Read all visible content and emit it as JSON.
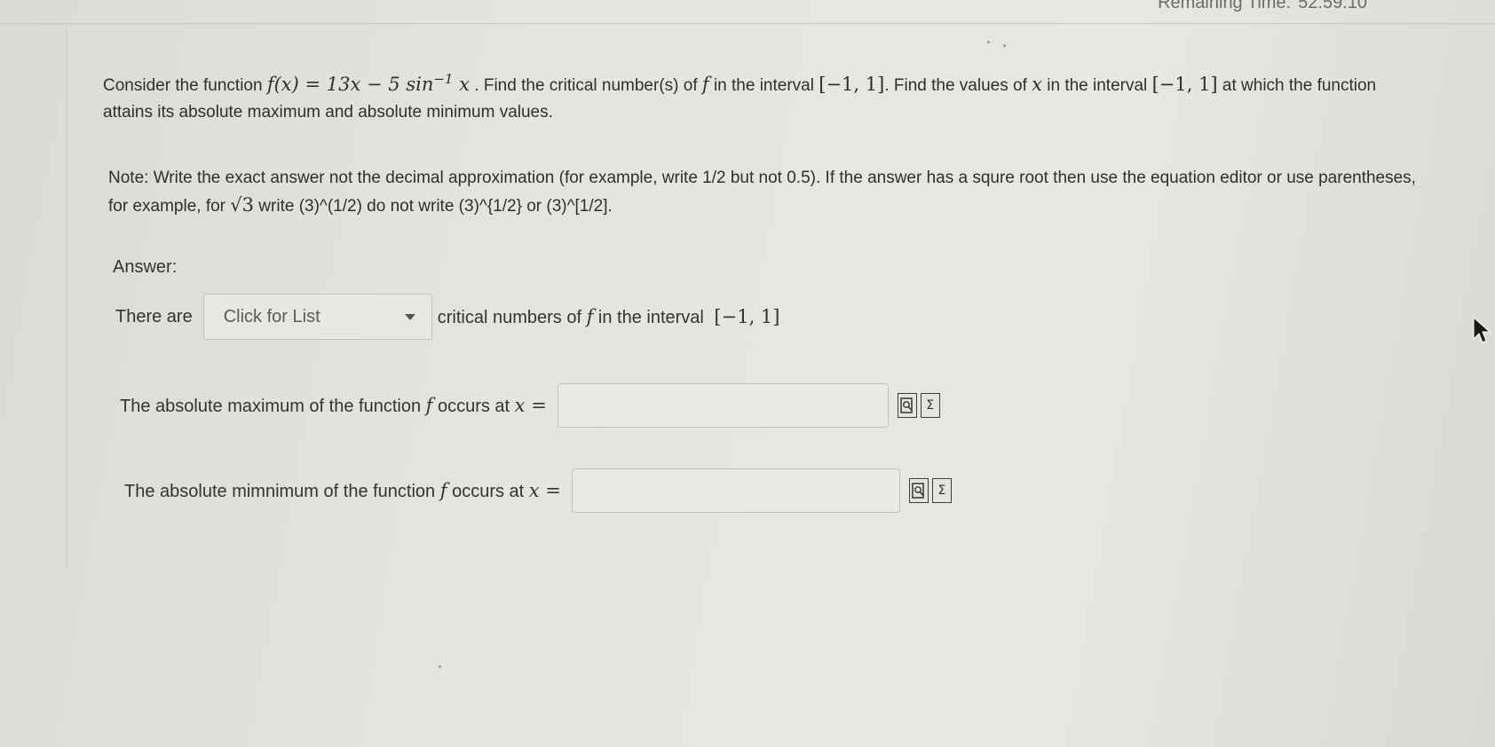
{
  "header": {
    "timer_label": "Remaining Time:",
    "timer_value": "52:59:10"
  },
  "question": {
    "p1_a": "Consider the function ",
    "p1_math_fx": "f(x) = 13x − 5 sin",
    "p1_math_sup": "−1",
    "p1_math_x": " x",
    "p1_b": " . Find the critical number(s) of ",
    "p1_f": "f",
    "p1_c": " in the interval ",
    "p1_interval1": "[−1, 1]",
    "p1_d": ". Find the values of ",
    "p1_x": "x",
    "p1_e": " in the interval ",
    "p1_interval2": "[−1, 1]",
    "p1_f_text": " at which the function attains its absolute maximum and absolute minimum values.",
    "p2_a": "Note: Write the exact answer not the decimal approximation (for example, write 1/2 but not 0.5). If the answer has a squre root then use the equation editor or use parentheses, for example, for ",
    "p2_sqrt": "√3",
    "p2_b": " write (3)^(1/2) do not write (3)^{1/2} or (3)^[1/2]."
  },
  "answer": {
    "label": "Answer:",
    "row1_prefix": "There are",
    "dropdown_value": "Click for List",
    "row1_suffix_a": "critical numbers of ",
    "row1_f": "f",
    "row1_suffix_b": " in the interval ",
    "row1_interval": "[−1, 1]",
    "row2_label_a": "The absolute maximum of the function ",
    "row2_f": "f",
    "row2_label_b": " occurs at ",
    "row2_eq": "x =",
    "row2_value": "",
    "row3_label_a": "The absolute mimnimum of the function ",
    "row3_f": "f",
    "row3_label_b": " occurs at ",
    "row3_eq": "x =",
    "row3_value": ""
  },
  "icons": {
    "preview": "preview-icon",
    "equation_editor": "equation-editor-icon",
    "cursor": "mouse-cursor-icon"
  }
}
